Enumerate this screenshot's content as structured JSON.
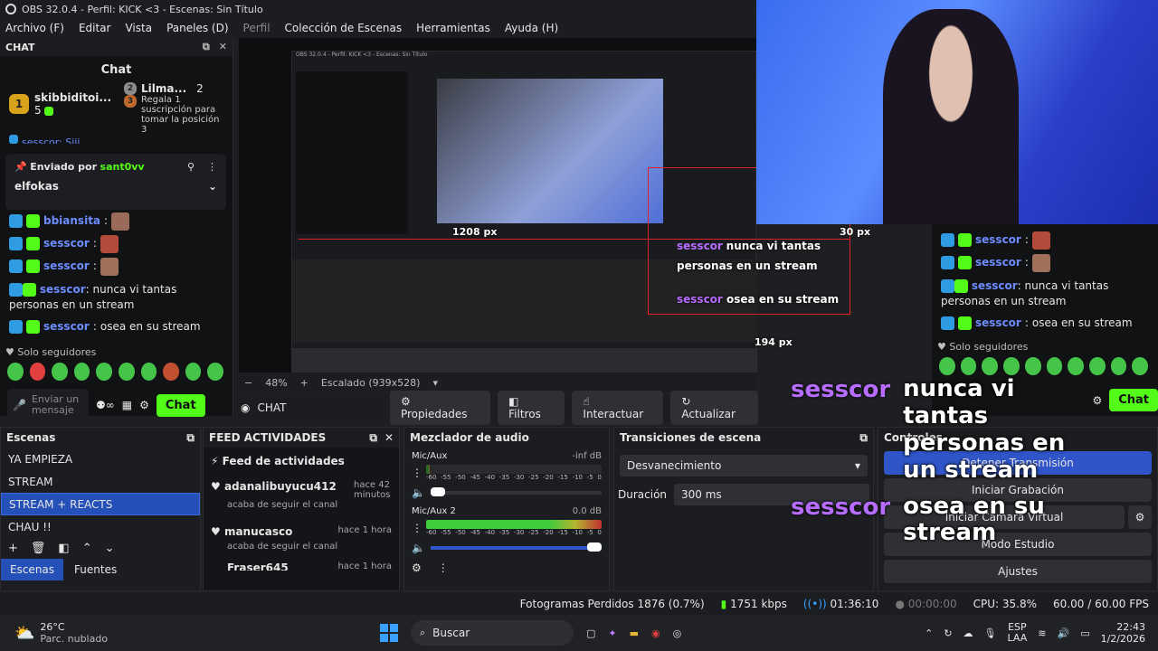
{
  "window": {
    "title": "OBS 32.0.4 - Perfil: KICK <3 - Escenas: Sin Título"
  },
  "menu": [
    "Archivo (F)",
    "Editar",
    "Vista",
    "Paneles (D)",
    "Perfil",
    "Colección de Escenas",
    "Herramientas",
    "Ayuda (H)"
  ],
  "chat_panel": {
    "dock_title": "CHAT",
    "title": "Chat",
    "gift": {
      "user1": "skibbiditoi...",
      "count1": "5",
      "user2": "Lilma...",
      "count2": "2",
      "gift_text": "Regala 1 suscripción para tomar la posición 3"
    },
    "top_partial": "sesscor: Siii",
    "pinned": {
      "label": "Enviado por",
      "by": "sant0vv",
      "text": "elfokas"
    },
    "messages": [
      {
        "user": "bbiansita",
        "text": ""
      },
      {
        "user": "sesscor",
        "text": ""
      },
      {
        "user": "sesscor",
        "text": ""
      },
      {
        "user": "sesscor",
        "text": "nunca vi tantas personas en un stream"
      },
      {
        "user": "sesscor",
        "text": "osea en su stream"
      }
    ],
    "followers_only": "Solo seguidores",
    "input_placeholder": "Enviar un mensaje",
    "send_button": "Chat"
  },
  "preview": {
    "zoom": "48%",
    "scaling": "Escalado (939x528)",
    "px_1208": "1208 px",
    "px_30": "30 px",
    "px_194": "194 px",
    "overlay_user": "sesscor",
    "overlay_msg1": "nunca vi tantas personas en un stream",
    "overlay_msg2": "osea en su stream"
  },
  "source_toolbar": {
    "name": "CHAT",
    "properties": "Propiedades",
    "filters": "Filtros",
    "interact": "Interactuar",
    "refresh": "Actualizar"
  },
  "scenes": {
    "title": "Escenas",
    "items": [
      "YA EMPIEZA",
      "STREAM",
      "STREAM + REACTS",
      "CHAU !!"
    ],
    "selected": 2,
    "tab_scenes": "Escenas",
    "tab_sources": "Fuentes"
  },
  "feed": {
    "dock_title": "FEED ACTIVIDADES",
    "title": "Feed de actividades",
    "items": [
      {
        "user": "adanalibuyucu412",
        "action": "acaba de seguir el canal",
        "time": "hace 42 minutos"
      },
      {
        "user": "manucasco",
        "action": "acaba de seguir el canal",
        "time": "hace 1 hora"
      },
      {
        "user": "Fraser645",
        "action": "",
        "time": "hace 1 hora"
      }
    ]
  },
  "mixer": {
    "title": "Mezclador de audio",
    "channels": [
      {
        "name": "Mic/Aux",
        "db": "-inf dB",
        "level": 0.0
      },
      {
        "name": "Mic/Aux 2",
        "db": "0.0 dB",
        "level": 1.0
      }
    ],
    "scale": [
      "-60",
      "-55",
      "-50",
      "-45",
      "-40",
      "-35",
      "-30",
      "-25",
      "-20",
      "-15",
      "-10",
      "-5",
      "0"
    ]
  },
  "transitions": {
    "title": "Transiciones de escena",
    "type": "Desvanecimiento",
    "duration_label": "Duración",
    "duration_value": "300 ms"
  },
  "controls": {
    "title": "Controles",
    "stop_stream": "Detener Transmisión",
    "start_recording": "Iniciar Grabación",
    "virtual_cam": "Iniciar Cámara Virtual",
    "studio_mode": "Modo Estudio",
    "settings": "Ajustes"
  },
  "overlay_big": {
    "user": "sesscor",
    "line1": "nunca vi tantas personas en un stream",
    "line2": "osea en su stream"
  },
  "status": {
    "dropped": "Fotogramas Perdidos 1876 (0.7%)",
    "kbps": "1751 kbps",
    "live_time": "01:36:10",
    "rec_time": "00:00:00",
    "cpu": "CPU: 35.8%",
    "fps": "60.00 / 60.00 FPS"
  },
  "taskbar": {
    "temp": "26°C",
    "weather": "Parc. nublado",
    "search": "Buscar",
    "lang1": "ESP",
    "lang2": "LAA",
    "time": "22:43",
    "date": "1/2/2026"
  },
  "colors": {
    "kick_green": "#53fc18",
    "obs_blue": "#2f55c9",
    "username": "#6c8cff",
    "overlay_user": "#b66cff"
  }
}
